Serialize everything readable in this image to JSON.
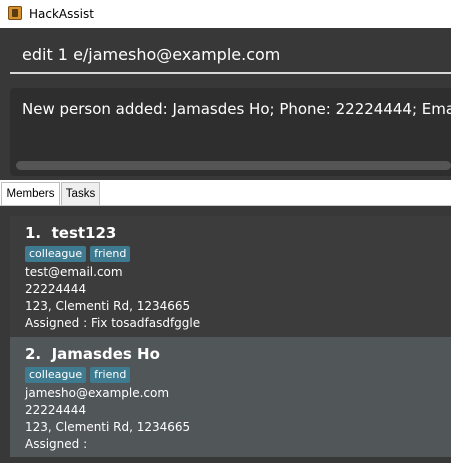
{
  "window": {
    "title": "HackAssist"
  },
  "command": {
    "value": "edit 1 e/jamesho@example.com"
  },
  "result": {
    "text": "New person added: Jamasdes Ho; Phone: 22224444; Email: jamesho@example.com"
  },
  "tabs": [
    {
      "label": "Members",
      "selected": true
    },
    {
      "label": "Tasks",
      "selected": false
    }
  ],
  "members": [
    {
      "index": "1.",
      "name": "test123",
      "tags": [
        "colleague",
        "friend"
      ],
      "email": "test@email.com",
      "phone": "22224444",
      "address": "123, Clementi Rd, 1234665",
      "assigned": "Assigned :  Fix tosadfasdfggle"
    },
    {
      "index": "2.",
      "name": "Jamasdes Ho",
      "tags": [
        "colleague",
        "friend"
      ],
      "email": "jamesho@example.com",
      "phone": "22224444",
      "address": "123, Clementi Rd, 1234665",
      "assigned": "Assigned :"
    }
  ],
  "colors": {
    "background": "#383838",
    "tag": "#3e7b91",
    "selected_card": "#515658"
  },
  "icons": {
    "app": "app-logo-icon"
  }
}
